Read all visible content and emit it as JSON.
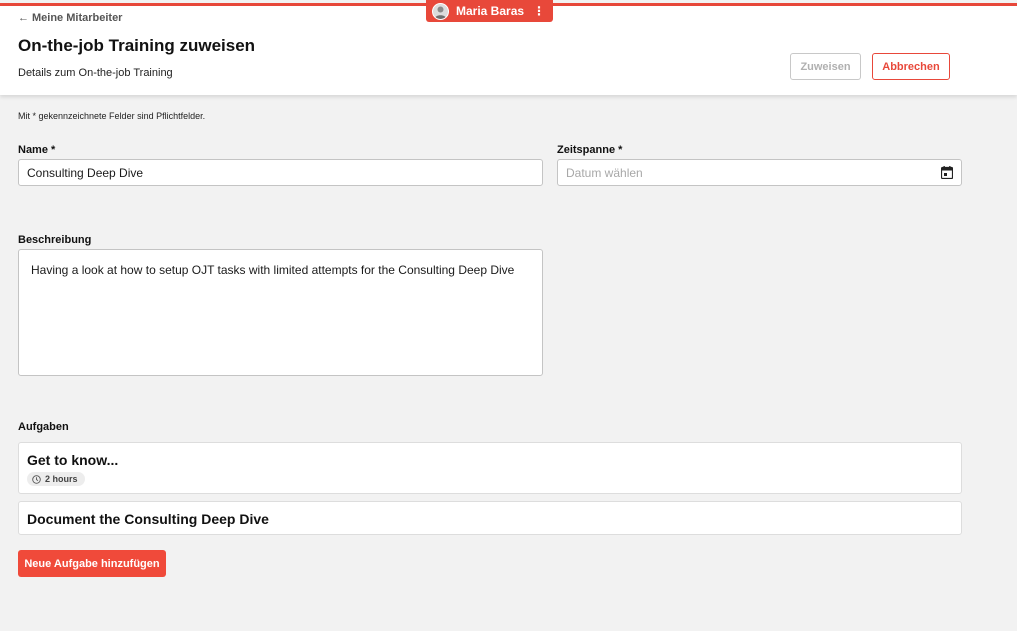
{
  "colors": {
    "accent": "#e8483a",
    "background": "#f2f2f2",
    "surface": "#ffffff",
    "disabled": "#b0b0b0"
  },
  "header": {
    "back_label": "Meine Mitarbeiter",
    "title": "On-the-job Training zuweisen",
    "subtitle": "Details zum On-the-job Training",
    "assign_label": "Zuweisen",
    "cancel_label": "Abbrechen"
  },
  "user": {
    "name": "Maria Baras",
    "menu_icon": "kebab-menu-icon"
  },
  "form": {
    "required_note": "Mit * gekennzeichnete Felder sind Pflichtfelder.",
    "name_label": "Name *",
    "name_value": "Consulting Deep Dive",
    "period_label": "Zeitspanne *",
    "period_placeholder": "Datum wählen",
    "period_icon": "calendar-icon",
    "description_label": "Beschreibung",
    "description_value": "Having a look at how to setup OJT tasks with limited attempts for the Consulting Deep Dive"
  },
  "tasks": {
    "label": "Aufgaben",
    "items": [
      {
        "title": "Get to know...",
        "duration": "2 hours"
      },
      {
        "title": "Document the Consulting Deep Dive"
      }
    ],
    "add_label": "Neue Aufgabe hinzufügen"
  }
}
